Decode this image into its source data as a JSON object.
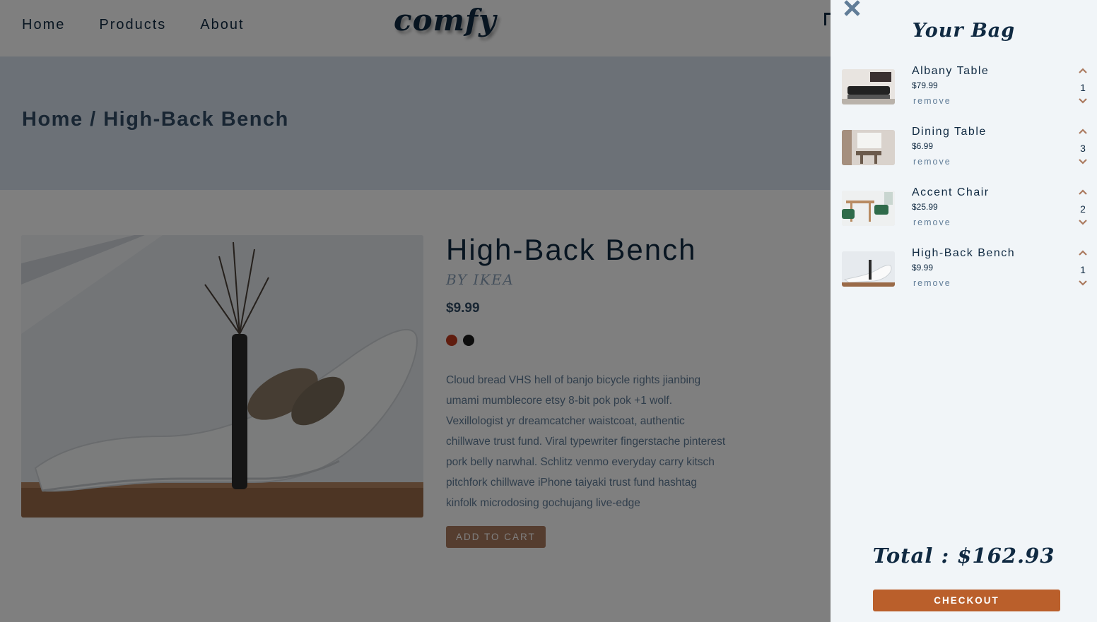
{
  "nav": {
    "links": [
      "Home",
      "Products",
      "About"
    ],
    "logo": "comfy"
  },
  "hero": {
    "breadcrumb": "Home / High-Back Bench"
  },
  "product": {
    "title": "High-Back Bench",
    "company": "BY IKEA",
    "price": "$9.99",
    "colors": [
      "#c13a1e",
      "#1a1a1a"
    ],
    "description": "Cloud bread VHS hell of banjo bicycle rights jianbing umami mumblecore etsy 8-bit pok pok +1 wolf. Vexillologist yr dreamcatcher waistcoat, authentic chillwave trust fund. Viral typewriter fingerstache pinterest pork belly narwhal. Schlitz venmo everyday carry kitsch pitchfork chillwave iPhone taiyaki trust fund hashtag kinfolk microdosing gochujang live-edge",
    "add_to_cart": "ADD TO CART"
  },
  "cart": {
    "title": "Your Bag",
    "items": [
      {
        "name": "Albany Table",
        "price": "$79.99",
        "remove": "remove",
        "qty": "1"
      },
      {
        "name": "Dining Table",
        "price": "$6.99",
        "remove": "remove",
        "qty": "3"
      },
      {
        "name": "Accent Chair",
        "price": "$25.99",
        "remove": "remove",
        "qty": "2"
      },
      {
        "name": "High-Back Bench",
        "price": "$9.99",
        "remove": "remove",
        "qty": "1"
      }
    ],
    "total": "Total : $162.93",
    "checkout": "CHECKOUT"
  },
  "colors": {
    "accent": "#ba5f2b",
    "primary_text": "#102a42",
    "overlay": "rgba(0,0,0,0.5)"
  }
}
